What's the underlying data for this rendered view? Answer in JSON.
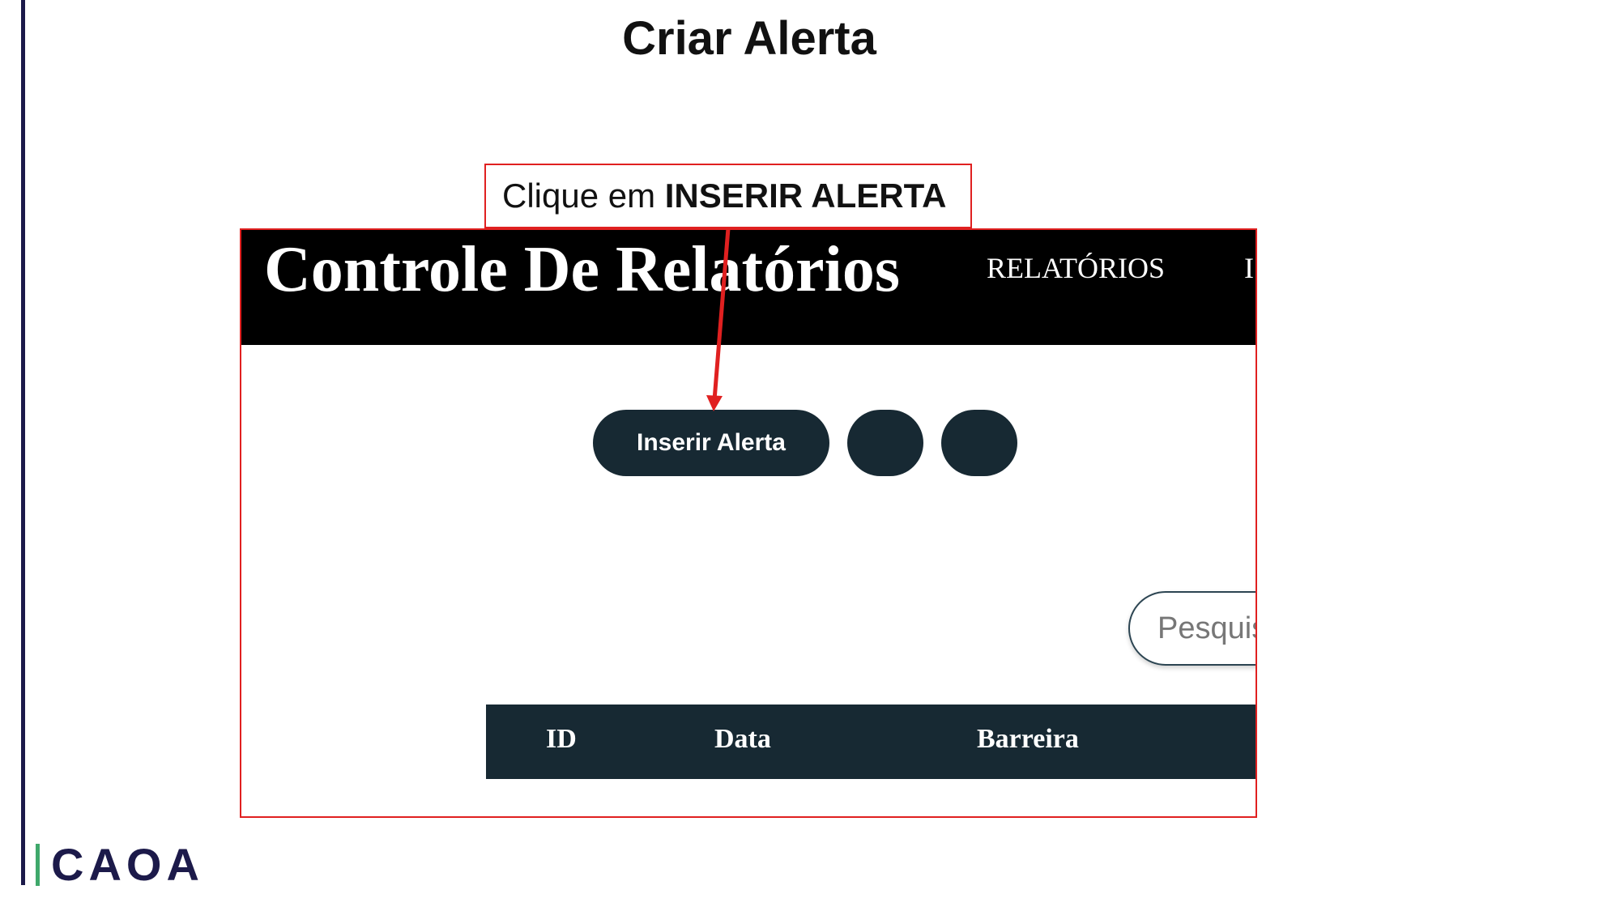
{
  "slide": {
    "title": "Criar Alerta"
  },
  "callout": {
    "prefix": "Clique em ",
    "emphasis": "INSERIR ALERTA"
  },
  "app": {
    "brand": "Controle De Relatórios",
    "nav": [
      "RELATÓRIOS",
      "I"
    ],
    "insert_button_label": "Inserir Alerta",
    "search_placeholder": "Pesquisar",
    "table_headers": [
      "ID",
      "Data",
      "Barreira"
    ]
  },
  "logo": {
    "text": "CAOA"
  },
  "colors": {
    "accent": "#e02020",
    "dark": "#172933",
    "navbar": "#000000",
    "logo_navy": "#1c1a4a",
    "logo_green": "#3fa86b"
  }
}
